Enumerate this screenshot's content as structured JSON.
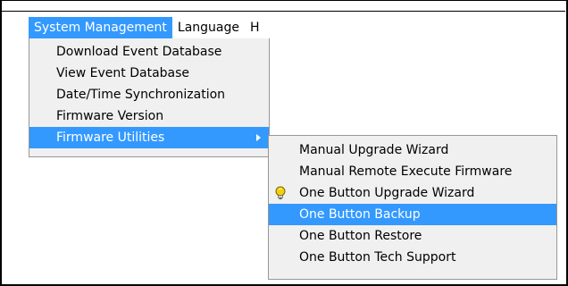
{
  "menubar": {
    "items": [
      {
        "label": "System Management"
      },
      {
        "label": "Language"
      },
      {
        "label": "H"
      }
    ]
  },
  "system_menu": {
    "items": [
      {
        "label": "Download Event Database"
      },
      {
        "label": "View Event Database"
      },
      {
        "label": "Date/Time Synchronization"
      },
      {
        "label": "Firmware Version"
      },
      {
        "label": "Firmware Utilities"
      }
    ]
  },
  "firmware_submenu": {
    "items": [
      {
        "label": "Manual Upgrade Wizard"
      },
      {
        "label": "Manual Remote Execute Firmware"
      },
      {
        "label": "One Button Upgrade Wizard",
        "icon": "lightbulb-icon"
      },
      {
        "label": "One Button Backup"
      },
      {
        "label": "One Button Restore"
      },
      {
        "label": "One Button Tech Support"
      }
    ]
  },
  "colors": {
    "highlight": "#3399ff",
    "menu_bg": "#f0f0f0",
    "bulb": "#f5d000"
  }
}
